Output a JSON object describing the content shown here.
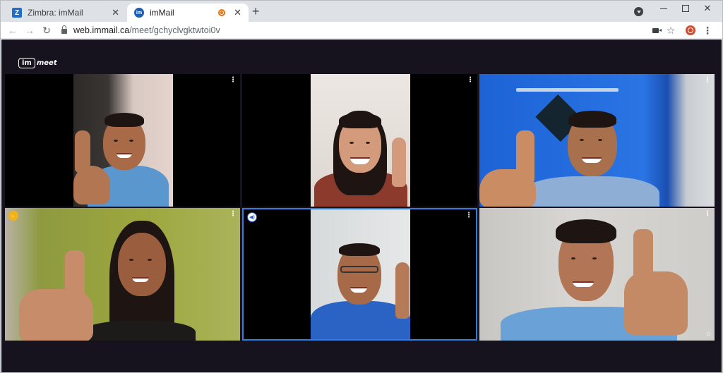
{
  "browser": {
    "tabs": [
      {
        "title": "Zimbra: imMail",
        "favicon": "Z",
        "active": false
      },
      {
        "title": "imMail",
        "favicon": "im",
        "active": true,
        "recording": true
      }
    ],
    "url_host": "web.immail.ca",
    "url_path": "/meet/gchyclvgktwtoi0v",
    "icons": [
      "back-arrow-icon",
      "forward-arrow-icon",
      "reload-icon",
      "lock-icon",
      "camera-icon",
      "star-icon",
      "extension-icon",
      "menu-dots-icon"
    ]
  },
  "app": {
    "logo_box": "im",
    "logo_word": "meet"
  },
  "tiles": [
    {
      "id": 1,
      "menu": "⋮"
    },
    {
      "id": 2,
      "menu": "⋮"
    },
    {
      "id": 3,
      "menu": "⋮"
    },
    {
      "id": 4,
      "menu": "⋮",
      "badge": "raised-hand"
    },
    {
      "id": 5,
      "menu": "⋮",
      "badge": "active-speaker",
      "highlighted": true
    },
    {
      "id": 6,
      "menu": "⋮",
      "pinned": true
    }
  ],
  "colors": {
    "meeting_bg": "#16131f",
    "active_speaker_border": "#2f7de1",
    "raised_hand": "#f2b21b",
    "tabstrip": "#dee1e6"
  }
}
